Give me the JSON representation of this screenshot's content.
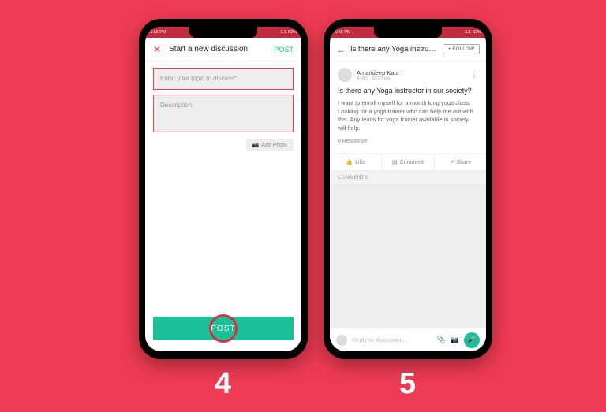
{
  "steps": {
    "left": "4",
    "right": "5"
  },
  "statusbar": {
    "time": "6:56 PM",
    "net": "1.1",
    "batt": "62%"
  },
  "screen4": {
    "header_title": "Start a new discussion",
    "header_post": "POST",
    "topic_placeholder": "Enter your topic to discuss*",
    "desc_placeholder": "Description",
    "add_photo": "Add Photo",
    "post_button": "POST"
  },
  "screen5": {
    "header_title": "Is there any Yoga instruct...",
    "follow": "FOLLOW",
    "author": {
      "name": "Amandeep Kaur",
      "meta": "A-081 · 02:53 pm"
    },
    "post_title": "Is there any Yoga instructor in our society?",
    "post_body": "I want to enroll myself for a month long yoga class. Looking for a yoga trainer who can help me out with this. Any leads for yoga trainer available in society will help.",
    "responses": "0 Response",
    "like": "Like",
    "comment": "Comment",
    "share": "Share",
    "comments_header": "COMMENTS",
    "reply_placeholder": "Reply to discussion..."
  }
}
